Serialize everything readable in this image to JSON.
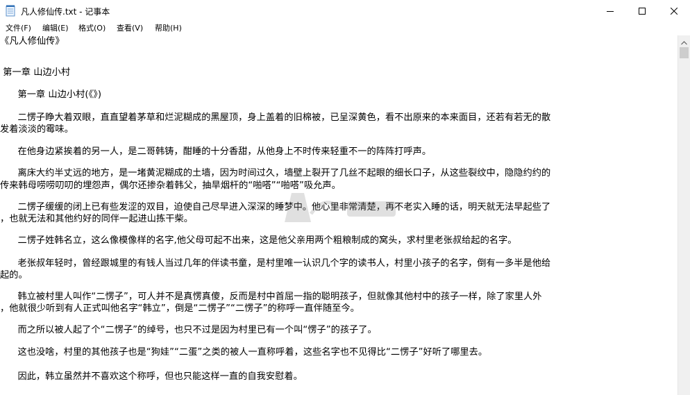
{
  "window": {
    "title": "凡人修仙传.txt - 记事本",
    "icons": {
      "app": "notepad-icon",
      "minimize": "minimize-icon",
      "maximize": "maximize-icon",
      "close": "close-icon"
    }
  },
  "menu": {
    "file": "文件(F)",
    "edit": "编辑(E)",
    "format": "格式(O)",
    "view": "查看(V)",
    "help": "帮助(H)"
  },
  "document": {
    "lines": [
      "《凡人修仙传》",
      "",
      " 第一章 山边小村",
      "",
      "      第一章 山边小村(《》)",
      "",
      "      二愣子睁大着双眼，直直望着茅草和烂泥糊成的黑屋顶，身上盖着的旧棉被，已呈深黄色，看不出原来的本来面目，还若有若无的散",
      "发着淡淡的霉味。",
      "",
      "      在他身边紧挨着的另一人，是二哥韩铸，酣睡的十分香甜，从他身上不时传来轻重不一的阵阵打呼声。",
      "",
      "      离床大约半丈远的地方，是一堵黄泥糊成的土墙，因为时间过久，墙壁上裂开了几丝不起眼的细长口子，从这些裂纹中，隐隐约约的",
      "传来韩母唠唠叨叨的埋怨声，偶尔还掺杂着韩父，抽旱烟杆的“啪嗒”“啪嗒”吸允声。",
      "",
      "      二愣子缓缓的闭上已有些发涩的双目，迫使自己尽早进入深深的睡梦中。他心里非常清楚，再不老实入睡的话，明天就无法早起些了",
      "，也就无法和其他约好的同伴一起进山拣干柴。",
      "",
      "      二愣子姓韩名立，这么像模像样的名字,他父母可起不出来，这是他父亲用两个粗粮制成的窝头，求村里老张叔给起的名字。",
      "",
      "      老张叔年轻时，曾经跟城里的有钱人当过几年的伴读书童，是村里唯一认识几个字的读书人，村里小孩子的名字，倒有一多半是他给",
      "起的。",
      "",
      "      韩立被村里人叫作“二愣子”，可人并不是真愣真傻，反而是村中首屈一指的聪明孩子，但就像其他村中的孩子一样，除了家里人外",
      "，他就很少听到有人正式叫他名字“韩立”，倒是“二愣子”“二愣子”的称呼一直伴随至今。",
      "",
      "      而之所以被人起了个“二愣子”的绰号，也只不过是因为村里已有一个叫“愣子”的孩子了。",
      "",
      "      这也没啥，村里的其他孩子也是“狗娃”“二蛋”之类的被人一直称呼着，这些名字也不见得比“二愣子”好听了哪里去。",
      "",
      "      因此，韩立虽然并不喜欢这个称呼，但也只能这样一直的自我安慰着。"
    ]
  },
  "scrollbar": {
    "up_icon": "scroll-up-arrow-icon"
  }
}
